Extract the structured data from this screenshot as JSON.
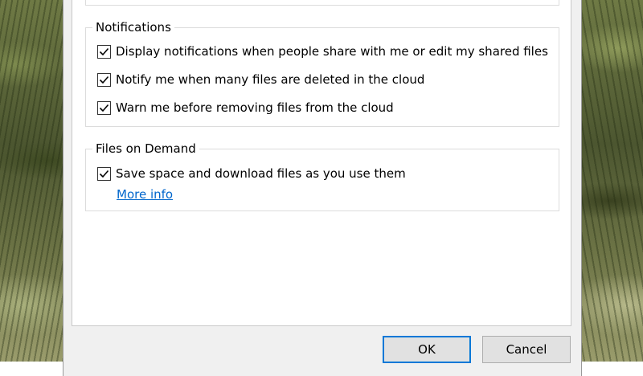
{
  "notifications": {
    "title": "Notifications",
    "items": [
      {
        "label": "Display notifications when people share with me or edit my shared files",
        "checked": true
      },
      {
        "label": "Notify me when many files are deleted in the cloud",
        "checked": true
      },
      {
        "label": "Warn me before removing files from the cloud",
        "checked": true
      }
    ]
  },
  "files_on_demand": {
    "title": "Files on Demand",
    "item": {
      "label": "Save space and download files as you use them",
      "checked": true
    },
    "link_label": "More info"
  },
  "buttons": {
    "ok_label": "OK",
    "cancel_label": "Cancel"
  },
  "colors": {
    "accent": "#0078d7",
    "link": "#0066cc",
    "dialog_bg": "#f0f0f0"
  }
}
